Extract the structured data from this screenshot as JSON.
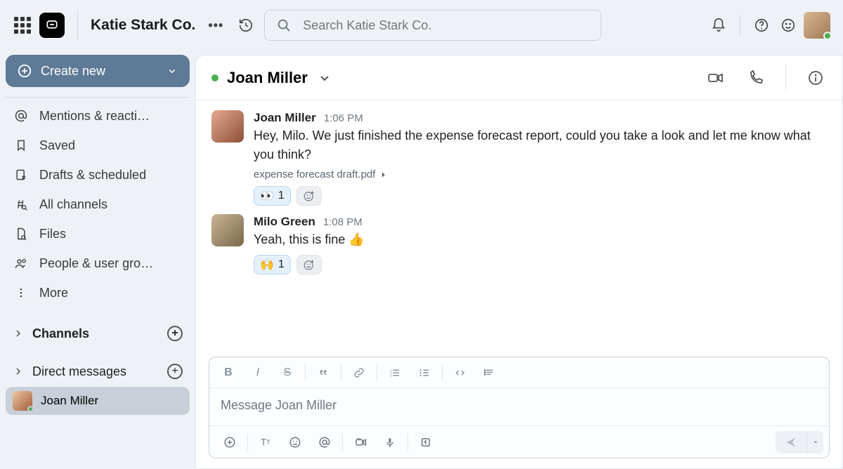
{
  "header": {
    "workspace": "Katie Stark Co.",
    "search_placeholder": "Search Katie Stark Co."
  },
  "sidebar": {
    "create_label": "Create new",
    "items": [
      {
        "icon": "at",
        "label": "Mentions & reacti…"
      },
      {
        "icon": "bookmark",
        "label": "Saved"
      },
      {
        "icon": "draft",
        "label": "Drafts & scheduled"
      },
      {
        "icon": "hash",
        "label": "All channels"
      },
      {
        "icon": "file",
        "label": "Files"
      },
      {
        "icon": "people",
        "label": "People & user gro…"
      },
      {
        "icon": "more",
        "label": "More"
      }
    ],
    "channels_label": "Channels",
    "dm_label": "Direct messages",
    "dm_user": "Joan Miller"
  },
  "chat": {
    "title": "Joan Miller",
    "messages": [
      {
        "sender": "Joan Miller",
        "time": "1:06 PM",
        "text": "Hey, Milo. We just finished the expense forecast report, could you take a look and let me know what you think?",
        "attachment": "expense forecast draft.pdf",
        "reactions": [
          {
            "emoji": "👀",
            "count": "1"
          }
        ]
      },
      {
        "sender": "Milo Green",
        "time": "1:08 PM",
        "text": "Yeah, this is fine 👍",
        "reactions": [
          {
            "emoji": "🙌",
            "count": "1"
          }
        ]
      }
    ],
    "compose_placeholder": "Message Joan Miller"
  }
}
